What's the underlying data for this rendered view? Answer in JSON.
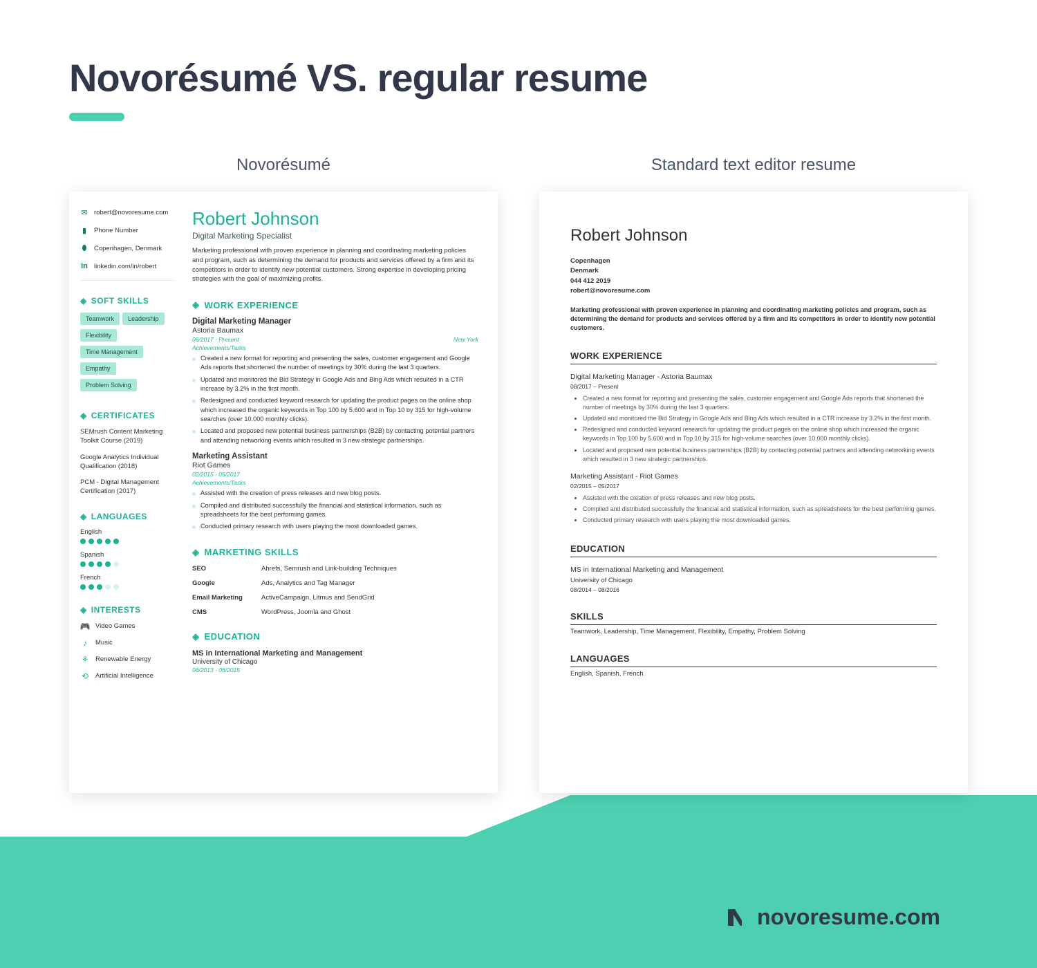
{
  "page_title": "Novorésumé VS. regular resume",
  "labels": {
    "novo": "Novorésumé",
    "standard": "Standard text editor resume"
  },
  "novo": {
    "name": "Robert Johnson",
    "role": "Digital Marketing Specialist",
    "summary": "Marketing professional with proven experience in planning and coordinating marketing policies and program, such as determining the demand for products and services offered by a firm and its competitors in order to identify new potential customers. Strong expertise in developing pricing strategies with the goal of maximizing profits.",
    "contacts": {
      "email": "robert@novoresume.com",
      "phone": "Phone Number",
      "location": "Copenhagen, Denmark",
      "linkedin": "linkedin.com/in/robert"
    },
    "headings": {
      "soft_skills": "SOFT SKILLS",
      "certificates": "CERTIFICATES",
      "languages": "LANGUAGES",
      "interests": "INTERESTS",
      "work": "WORK EXPERIENCE",
      "mskills": "MARKETING SKILLS",
      "education": "EDUCATION"
    },
    "soft_skills": [
      "Teamwork",
      "Leadership",
      "Flexibility",
      "Time Management",
      "Empathy",
      "Problem Solving"
    ],
    "certificates": [
      "SEMrush Content Marketing Toolkit Course (2019)",
      "Google Analytics Individual Qualification (2018)",
      "PCM - Digital Management Certification (2017)"
    ],
    "languages": [
      {
        "name": "English",
        "level": 5
      },
      {
        "name": "Spanish",
        "level": 4
      },
      {
        "name": "French",
        "level": 3
      }
    ],
    "interests": [
      "Video Games",
      "Music",
      "Renewable Energy",
      "Artificial Intelligence"
    ],
    "jobs": [
      {
        "title": "Digital Marketing Manager",
        "company": "Astoria Baumax",
        "dates": "06/2017 - Present",
        "location": "New York",
        "sub": "Achievements/Tasks",
        "bullets": [
          "Created a new format for reporting and presenting the sales, customer engagement and Google Ads reports that shortened the number of meetings by 30% during the last 3 quarters.",
          "Updated and monitored the Bid Strategy in Google Ads and Bing Ads which resulted in a CTR increase by 3.2% in the first month.",
          "Redesigned and conducted keyword research for updating the product pages on the online shop which increased the organic keywords in Top 100 by 5.600 and in Top 10 by 315 for high-volume searches (over 10.000 monthly clicks).",
          "Located and proposed new potential business partnerships (B2B) by contacting potential partners and attending networking events which resulted in 3 new strategic partnerships."
        ]
      },
      {
        "title": "Marketing Assistant",
        "company": "Riot Games",
        "dates": "02/2015 - 05/2017",
        "location": "",
        "sub": "Achievements/Tasks",
        "bullets": [
          "Assisted with the creation of press releases and new blog posts.",
          "Compiled and distributed successfully the financial and statistical information, such as spreadsheets for the best performing games.",
          "Conducted primary research with users playing the most downloaded games."
        ]
      }
    ],
    "mskills": [
      {
        "k": "SEO",
        "v": "Ahrefs, Semrush and Link-building Techniques"
      },
      {
        "k": "Google",
        "v": "Ads, Analytics and Tag Manager"
      },
      {
        "k": "Email Marketing",
        "v": "ActiveCampaign, Litmus and SendGrid"
      },
      {
        "k": "CMS",
        "v": "WordPress, Joomla and Ghost"
      }
    ],
    "education": {
      "degree": "MS in International Marketing and Management",
      "school": "University of Chicago",
      "dates": "06/2013 - 06/2015"
    }
  },
  "standard": {
    "name": "Robert Johnson",
    "contact": {
      "city": "Copenhagen",
      "country": "Denmark",
      "phone": "044 412 2019",
      "email": "robert@novoresume.com"
    },
    "summary": "Marketing professional with proven experience in planning and coordinating marketing policies and program, such as determining the demand for products and services offered by a firm and its competitors in order to identify new potential customers.",
    "headings": {
      "work": "WORK EXPERIENCE",
      "education": "EDUCATION",
      "skills": "SKILLS",
      "languages": "LANGUAGES"
    },
    "jobs": [
      {
        "title": "Digital Marketing Manager  - Astoria Baumax",
        "dates": "08/2017 – Present",
        "bullets": [
          "Created a new format for reporting and presenting the sales, customer engagement and Google Ads reports that shortened the number of meetings by 30% during the last 3 quarters.",
          "Updated and monitored the Bid Strategy in Google Ads and Bing Ads which resulted in a CTR increase by 3.2% in the first month.",
          "Redesigned and conducted keyword research for updating the product pages on the online shop which increased the organic keywords in Top 100 by 5.600 and in Top 10 by 315 for high-volume searches (over 10.000 monthly clicks).",
          "Located and proposed new potential business partnerships (B2B) by contacting potential partners and attending networking events which resulted in 3 new strategic partnerships."
        ]
      },
      {
        "title": "Marketing Assistant - Riot Games",
        "dates": "02/2015 – 05/2017",
        "bullets": [
          "Assisted with the creation of press releases and new blog posts.",
          "Compiled and distributed successfully the financial and statistical information, such as spreadsheets for the best performing games.",
          "Conducted primary research with users playing the most downloaded games."
        ]
      }
    ],
    "education": {
      "degree": "MS in International Marketing and Management",
      "school": "University of Chicago",
      "dates": "08/2014 – 08/2016"
    },
    "skills": "Teamwork, Leadership, Time Management, Flexibility, Empathy, Problem Solving",
    "languages": "English, Spanish, French"
  },
  "footer": {
    "brand": "novoresume.com"
  }
}
